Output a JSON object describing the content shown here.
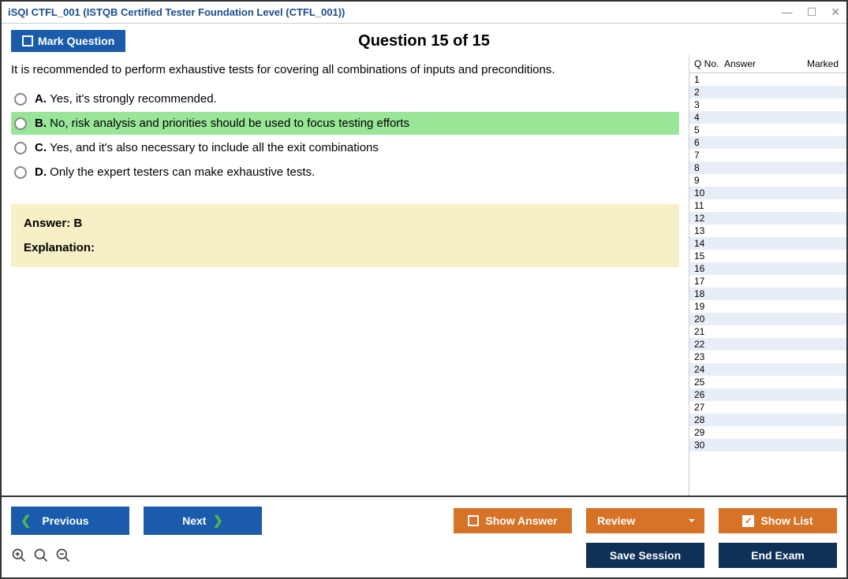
{
  "window": {
    "title": "iSQI CTFL_001 (ISTQB Certified Tester Foundation Level (CTFL_001))"
  },
  "header": {
    "mark_question_label": "Mark Question",
    "question_counter": "Question 15 of 15"
  },
  "question": {
    "text": "It is recommended to perform exhaustive tests for covering all combinations of inputs and preconditions.",
    "options": [
      {
        "letter": "A.",
        "text": "Yes, it's strongly recommended.",
        "correct": false
      },
      {
        "letter": "B.",
        "text": "No, risk analysis and priorities should be used to focus testing efforts",
        "correct": true
      },
      {
        "letter": "C.",
        "text": "Yes, and it's also necessary to include all the exit combinations",
        "correct": false
      },
      {
        "letter": "D.",
        "text": "Only the expert testers can make exhaustive tests.",
        "correct": false
      }
    ],
    "answer_label": "Answer: B",
    "explanation_label": "Explanation:"
  },
  "sidebar": {
    "col_qno": "Q No.",
    "col_answer": "Answer",
    "col_marked": "Marked",
    "rows": [
      1,
      2,
      3,
      4,
      5,
      6,
      7,
      8,
      9,
      10,
      11,
      12,
      13,
      14,
      15,
      16,
      17,
      18,
      19,
      20,
      21,
      22,
      23,
      24,
      25,
      26,
      27,
      28,
      29,
      30
    ]
  },
  "bottom": {
    "previous": "Previous",
    "next": "Next",
    "show_answer": "Show Answer",
    "review": "Review",
    "show_list": "Show List",
    "save_session": "Save Session",
    "end_exam": "End Exam"
  }
}
